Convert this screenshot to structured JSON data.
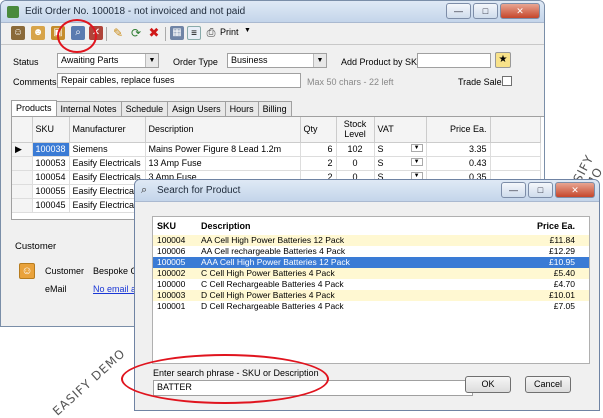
{
  "main": {
    "title": "Edit Order No. 100018 - not invoiced and not paid",
    "window_controls": [
      "—",
      "□",
      "✕"
    ],
    "toolbar": {
      "print_label": "Print"
    },
    "status_label": "Status",
    "status_value": "Awaiting Parts",
    "order_type_label": "Order Type",
    "order_type_value": "Business",
    "add_product_label": "Add Product by SKU",
    "comments_label": "Comments",
    "comments_value": "Repair cables, replace fuses",
    "comments_hint": "Max 50 chars - 22 left",
    "trade_sale_label": "Trade Sale",
    "tabs": [
      "Products",
      "Internal Notes",
      "Schedule",
      "Asign Users",
      "Hours",
      "Billing"
    ],
    "grid": {
      "columns": [
        "SKU",
        "Manufacturer",
        "Description",
        "Qty",
        "Stock Level",
        "VAT",
        "Price Ea."
      ],
      "rows": [
        {
          "sku": "100038",
          "manufacturer": "Siemens",
          "description": "Mains Power Figure 8 Lead 1.2m",
          "qty": "6",
          "stock": "102",
          "vat": "S",
          "price": "3.35"
        },
        {
          "sku": "100053",
          "manufacturer": "Easify Electricals",
          "description": "13 Amp Fuse",
          "qty": "2",
          "stock": "0",
          "vat": "S",
          "price": "0.43"
        },
        {
          "sku": "100054",
          "manufacturer": "Easify Electricals",
          "description": "3 Amp Fuse",
          "qty": "2",
          "stock": "0",
          "vat": "S",
          "price": "0.35"
        },
        {
          "sku": "100055",
          "manufacturer": "Easify Electricals",
          "description": "",
          "qty": "",
          "stock": "",
          "vat": "",
          "price": ""
        },
        {
          "sku": "100045",
          "manufacturer": "Easify Electricals",
          "description": "",
          "qty": "",
          "stock": "",
          "vat": "",
          "price": ""
        }
      ]
    },
    "customer": {
      "section_label": "Customer",
      "customer_label": "Customer",
      "customer_value": "Bespoke Ca",
      "email_label": "eMail",
      "email_value": "No email ac"
    }
  },
  "dialog": {
    "title": "Search for Product",
    "window_controls": [
      "—",
      "□",
      "✕"
    ],
    "columns": [
      "SKU",
      "Description",
      "Price Ea."
    ],
    "results": [
      {
        "sku": "100004",
        "description": "AA Cell High Power Batteries 12 Pack",
        "price": "£11.84"
      },
      {
        "sku": "100006",
        "description": "AA Cell rechargeable Batteries 4 Pack",
        "price": "£12.29"
      },
      {
        "sku": "100005",
        "description": "AAA Cell High Power Batteries 12 Pack",
        "price": "£10.95"
      },
      {
        "sku": "100002",
        "description": "C Cell High Power Batteries 4 Pack",
        "price": "£5.40"
      },
      {
        "sku": "100000",
        "description": "C Cell Rechargeable Batteries 4 Pack",
        "price": "£4.70"
      },
      {
        "sku": "100003",
        "description": "D Cell High Power Batteries 4 Pack",
        "price": "£10.01"
      },
      {
        "sku": "100001",
        "description": "D Cell Rechargeable Batteries 4 Pack",
        "price": "£7.05"
      }
    ],
    "search_label": "Enter search phrase - SKU or Description",
    "search_value": "BATTER",
    "ok_label": "OK",
    "cancel_label": "Cancel"
  },
  "watermark": "EASIFY DEMO",
  "colors": {
    "highlight": "#e0141e",
    "selection": "#3a7bd5",
    "alt_row": "#fff8d2"
  }
}
